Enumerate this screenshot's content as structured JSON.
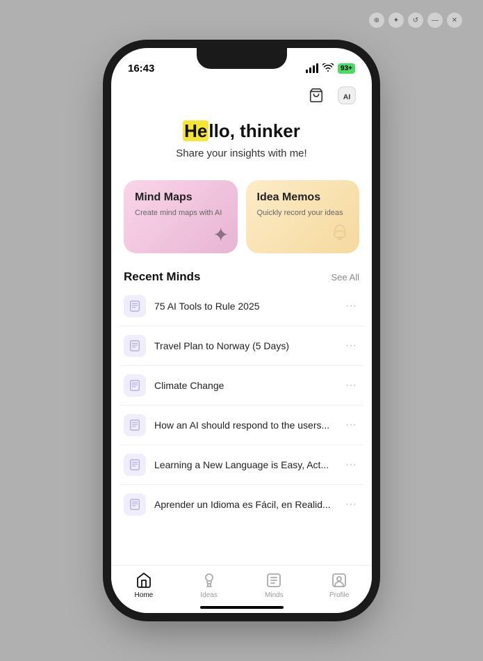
{
  "window": {
    "chrome_buttons": [
      "pin",
      "star",
      "history",
      "minimize",
      "close"
    ]
  },
  "status_bar": {
    "time": "16:43",
    "battery": "93+"
  },
  "top_actions": {
    "cart_icon": "🛒",
    "ai_icon": "AI"
  },
  "hero": {
    "greeting_prefix": "He",
    "greeting_suffix": "llo, thinker",
    "greeting_highlight": "He",
    "subtitle": "Share your insights with me!"
  },
  "cards": [
    {
      "id": "mind-maps",
      "title": "Mind Maps",
      "subtitle": "Create mind maps with AI",
      "icon": "✦"
    },
    {
      "id": "idea-memos",
      "title": "Idea Memos",
      "subtitle": "Quickly record your ideas",
      "icon": "💡"
    }
  ],
  "recent_section": {
    "title": "Recent Minds",
    "see_all": "See All"
  },
  "mind_items": [
    {
      "id": 1,
      "text": "75 AI Tools to Rule 2025"
    },
    {
      "id": 2,
      "text": "Travel Plan to Norway (5 Days)"
    },
    {
      "id": 3,
      "text": "Climate Change"
    },
    {
      "id": 4,
      "text": "How an AI should respond to the users..."
    },
    {
      "id": 5,
      "text": "Learning a New Language is Easy, Act..."
    },
    {
      "id": 6,
      "text": "Aprender un Idioma es Fácil, en Realid..."
    }
  ],
  "bottom_nav": [
    {
      "id": "home",
      "label": "Home",
      "active": true
    },
    {
      "id": "ideas",
      "label": "Ideas",
      "active": false
    },
    {
      "id": "minds",
      "label": "Minds",
      "active": false
    },
    {
      "id": "profile",
      "label": "Profile",
      "active": false
    }
  ]
}
